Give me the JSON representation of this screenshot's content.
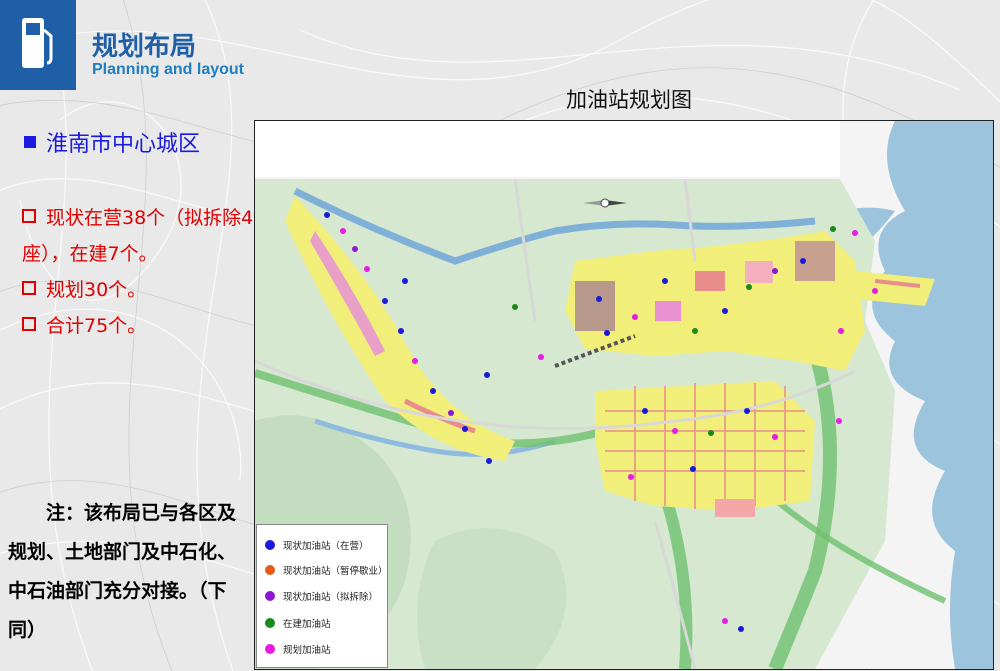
{
  "header": {
    "title": "规划布局",
    "subtitle": "Planning and layout"
  },
  "map": {
    "title": "加油站规划图"
  },
  "left_panel": {
    "section_title": "淮南市中心城区",
    "items": [
      "现状在营38个（拟拆除4座），在建7个。",
      "规划30个。",
      "合计75个。"
    ],
    "note": "注：该布局已与各区及规划、土地部门及中石化、中石油部门充分对接。（下同）"
  },
  "legend": {
    "items": [
      {
        "label": "现状加油站（在营）",
        "color": "#1a1adc"
      },
      {
        "label": "现状加油站（暂停歇业）",
        "color": "#e85a1a"
      },
      {
        "label": "现状加油站（拟拆除）",
        "color": "#8a1ad0"
      },
      {
        "label": "在建加油站",
        "color": "#1a8a1a"
      },
      {
        "label": "规划加油站",
        "color": "#e81ae8"
      }
    ]
  },
  "colors": {
    "brand_blue": "#1f5fa8",
    "accent_red": "#e00000",
    "section_blue": "#1a1ae0"
  }
}
